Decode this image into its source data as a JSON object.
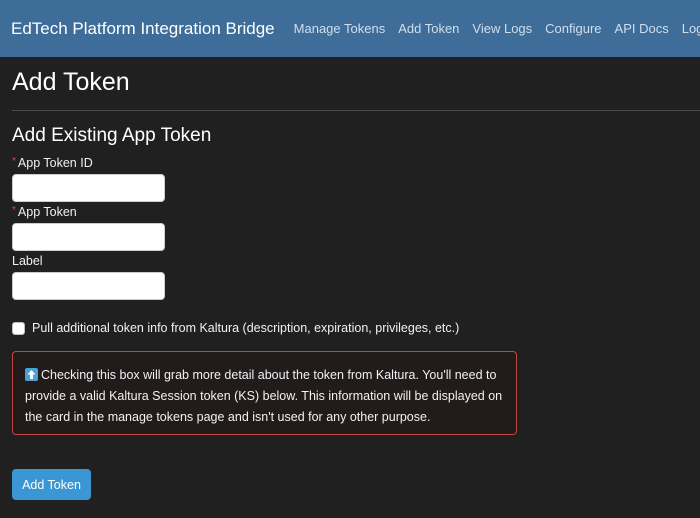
{
  "navbar": {
    "brand": "EdTech Platform Integration Bridge",
    "links": [
      "Manage Tokens",
      "Add Token",
      "View Logs",
      "Configure",
      "API Docs",
      "Logout"
    ],
    "background_color": "#3e6d99"
  },
  "page": {
    "title": "Add Token",
    "section_title": "Add Existing App Token"
  },
  "form": {
    "required_mark": "*",
    "app_token_id": {
      "label": "App Token ID",
      "value": "",
      "required": true
    },
    "app_token": {
      "label": "App Token",
      "value": "",
      "required": true
    },
    "label": {
      "label": "Label",
      "value": "",
      "required": false
    },
    "pull_info": {
      "label": "Pull additional token info from Kaltura (description, expiration, privileges, etc.)",
      "checked": false
    },
    "info_box": {
      "icon": "up-arrow-icon",
      "text": "Checking this box will grab more detail about the token from Kaltura. You'll need to provide a valid Kaltura Session token (KS) below. This information will be displayed on the card in the manage tokens page and isn't used for any other purpose.",
      "border_color": "#c2463f"
    },
    "submit_label": "Add Token",
    "submit_color": "#3a97d4"
  }
}
